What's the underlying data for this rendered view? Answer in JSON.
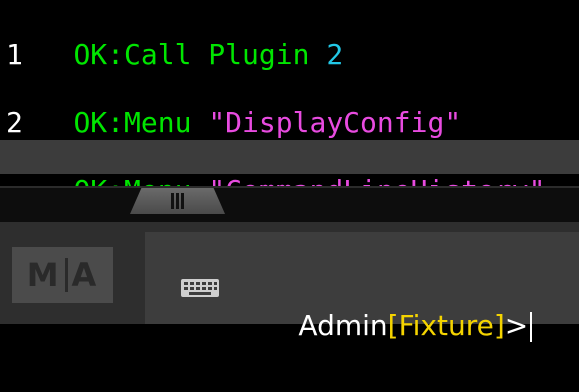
{
  "console": {
    "lines": [
      {
        "prefix": "OK:",
        "command": "Call Plugin ",
        "arg": "2"
      },
      {
        "output": "1"
      },
      {
        "prefix": "OK:",
        "command": "Menu ",
        "arg": "\"DisplayConfig\""
      },
      {
        "output": "2"
      },
      {
        "prefix": "OK:",
        "command": "Menu ",
        "arg": "\"CommandLineHistory\""
      }
    ]
  },
  "logo": {
    "left": "M",
    "right": "A"
  },
  "command_line": {
    "user": "Admin",
    "object": "[Fixture]",
    "prompt": ">"
  },
  "colors": {
    "ok": "#00e600",
    "number_arg": "#22c7e6",
    "string_arg": "#e84be0",
    "object": "#f5d400",
    "highlight_row": "#3c3c3c"
  },
  "icons": {
    "keyboard": "keyboard-icon",
    "drag": "drag-handle"
  }
}
